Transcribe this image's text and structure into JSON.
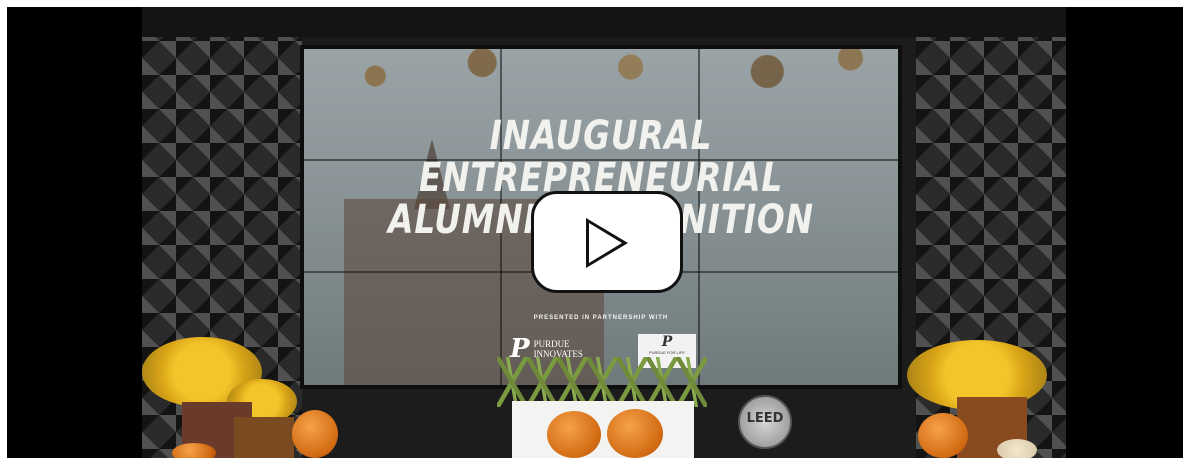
{
  "video": {
    "headline_line1": "INAUGURAL",
    "headline_line2": "ENTREPRENEURIAL",
    "headline_line3": "ALUMNI RECOGNITION",
    "partner_text": "PRESENTED IN PARTNERSHIP WITH",
    "logo1_mark": "P",
    "logo1_line1": "PURDUE",
    "logo1_line2": "INNOVATES",
    "logo2_mark": "P",
    "logo2_text": "PURDUE FOR LIFE",
    "leed_text": "LEED"
  },
  "icons": {
    "play": "play-icon"
  },
  "colors": {
    "play_button_bg": "#ffffff",
    "play_button_border": "#111111",
    "headline_text": "#f1f1ee",
    "pumpkin": "#d26a12",
    "flowers": "#f3c52a"
  }
}
